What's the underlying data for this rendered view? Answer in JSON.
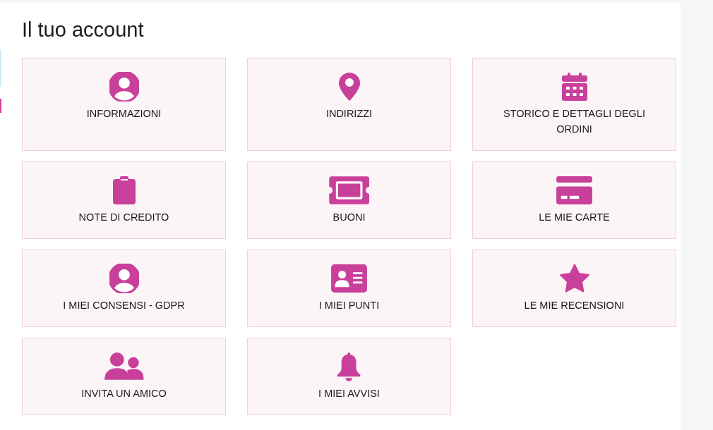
{
  "title": "Il tuo account",
  "tiles": [
    {
      "kind": "user",
      "label": "INFORMAZIONI"
    },
    {
      "kind": "pin",
      "label": "INDIRIZZI"
    },
    {
      "kind": "calendar",
      "label": "STORICO E DETTAGLI DEGLI ORDINI"
    },
    {
      "kind": "clipboard",
      "label": "NOTE DI CREDITO"
    },
    {
      "kind": "ticket",
      "label": "BUONI"
    },
    {
      "kind": "card",
      "label": "LE MIE CARTE"
    },
    {
      "kind": "user",
      "label": "I MIEI CONSENSI - GDPR"
    },
    {
      "kind": "idcard",
      "label": "I MIEI PUNTI"
    },
    {
      "kind": "star",
      "label": "LE MIE RECENSIONI"
    },
    {
      "kind": "users",
      "label": "INVITA UN AMICO"
    },
    {
      "kind": "bell",
      "label": "I MIEI AVVISI"
    }
  ]
}
